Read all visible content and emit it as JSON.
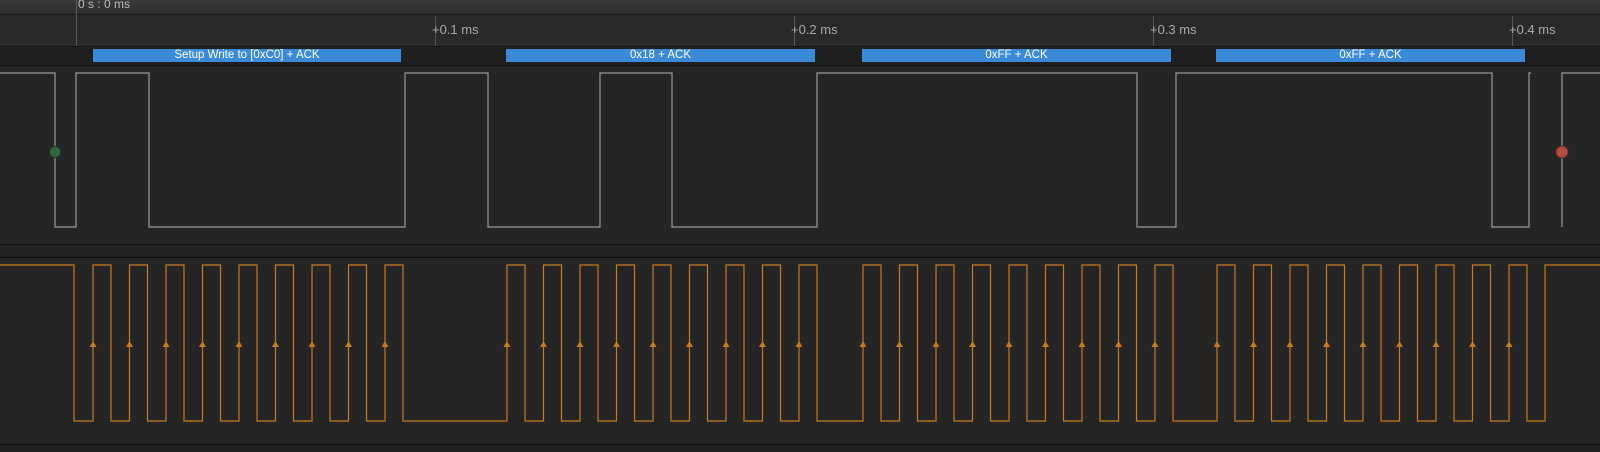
{
  "timeline": {
    "origin_label": "0 s : 0 ms",
    "ticks": [
      "+0.1 ms",
      "+0.2 ms",
      "+0.3 ms",
      "+0.4 ms"
    ]
  },
  "decoder": {
    "frames": [
      "Setup Write to [0xC0] + ACK",
      "0x18 + ACK",
      "0xFF + ACK",
      "0xFF + ACK"
    ],
    "color": "#3a8ad8"
  },
  "markers": {
    "start": {
      "color": "#2e6b3e"
    },
    "stop": {
      "color": "#b34a3c"
    }
  },
  "channels": {
    "sda": {
      "color": "#9a9a9a"
    },
    "scl": {
      "color": "#c77a1e"
    }
  }
}
